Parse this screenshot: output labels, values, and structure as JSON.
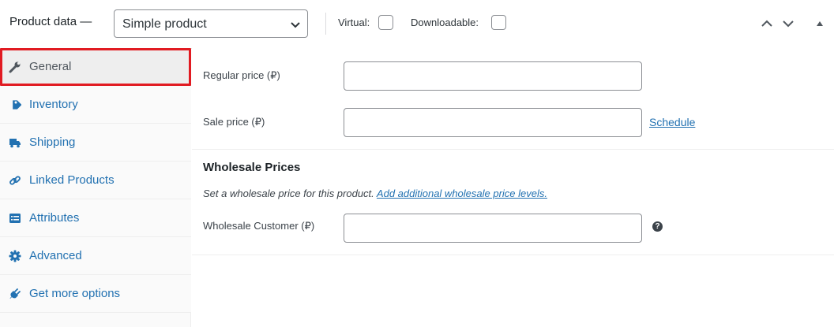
{
  "header": {
    "title": "Product data —",
    "product_type": "Simple product",
    "virtual_label": "Virtual:",
    "downloadable_label": "Downloadable:"
  },
  "tabs": [
    {
      "label": "General",
      "icon": "wrench-icon",
      "active": true
    },
    {
      "label": "Inventory",
      "icon": "tag-icon",
      "active": false
    },
    {
      "label": "Shipping",
      "icon": "truck-icon",
      "active": false
    },
    {
      "label": "Linked Products",
      "icon": "link-icon",
      "active": false
    },
    {
      "label": "Attributes",
      "icon": "list-icon",
      "active": false
    },
    {
      "label": "Advanced",
      "icon": "gear-icon",
      "active": false
    },
    {
      "label": "Get more options",
      "icon": "plugin-icon",
      "active": false
    }
  ],
  "general": {
    "regular_price_label": "Regular price (₽)",
    "sale_price_label": "Sale price (₽)",
    "schedule_link": "Schedule",
    "regular_price_value": "",
    "sale_price_value": ""
  },
  "wholesale": {
    "title": "Wholesale Prices",
    "description": "Set a wholesale price for this product.",
    "add_levels_link": "Add additional wholesale price levels.",
    "customer_label": "Wholesale Customer (₽)",
    "customer_value": "",
    "help_icon": "?"
  },
  "colors": {
    "link": "#2271b1",
    "highlight": "#e11b22"
  }
}
